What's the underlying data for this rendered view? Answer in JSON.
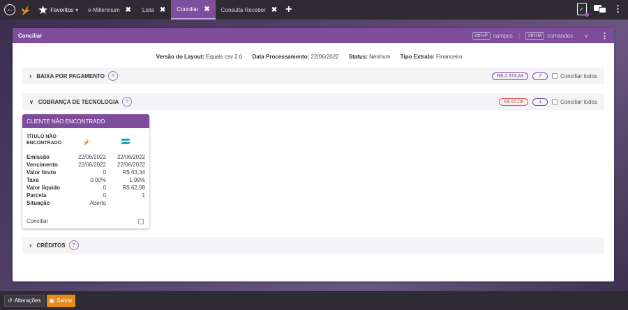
{
  "topbar": {
    "favorites_label": "Favoritos",
    "favorites_caret": "▾",
    "tabs": [
      {
        "label": "e-Millennium",
        "close": "✖"
      },
      {
        "label": "Lista",
        "close": "✖"
      },
      {
        "label": "Conciliar",
        "close": "✖"
      },
      {
        "label": "Consulta Receber",
        "close": "✖"
      }
    ],
    "add_tab": "+"
  },
  "panel": {
    "title": "Conciliar",
    "shortcut_fields_key": "ctrl+P",
    "shortcut_fields_label": "campos",
    "separator": "|",
    "shortcut_commands_key": "ctrl+M",
    "shortcut_commands_label": "comandos"
  },
  "info": {
    "layout_label": "Versão do Layout:",
    "layout_value": "Equals csv 2.0",
    "date_label": "Data Processamento:",
    "date_value": "22/06/2022",
    "status_label": "Status:",
    "status_value": "Nenhum",
    "type_label": "Tipo Extrato:",
    "type_value": "Financeiro"
  },
  "sections": {
    "baixa": {
      "title": "BAIXA POR PAGAMENTO",
      "help": "?",
      "amount": "R$ 2.373,43",
      "count": "7",
      "conciliate_all": "Conciliar todos"
    },
    "cobranca": {
      "title": "COBRANÇA DE TECNOLOGIA",
      "help": "?",
      "amount": "R$ 62,08",
      "count": "1",
      "conciliate_all": "Conciliar todos"
    },
    "creditos": {
      "title": "CRÉDITOS",
      "help": "?"
    }
  },
  "card": {
    "header": "CLIENTE NÃO ENCONTRADO",
    "subtitle_line1": "TÍTULO NÃO",
    "subtitle_line2": "ENCONTRADO",
    "rows": [
      {
        "label": "Emissão",
        "a": "22/06/2022",
        "b": "22/06/2022"
      },
      {
        "label": "Vencimento",
        "a": "22/06/2022",
        "b": "22/06/2022"
      },
      {
        "label": "Valor bruto",
        "a": "0",
        "b": "R$ 63,34"
      },
      {
        "label": "Taxa",
        "a": "0.00%",
        "b": "1.99%"
      },
      {
        "label": "Valor líquido",
        "a": "0",
        "b": "R$ 62,08"
      },
      {
        "label": "Parcela",
        "a": "0",
        "b": "1"
      },
      {
        "label": "Situação",
        "a": "Aberto",
        "b": ""
      }
    ],
    "footer_label": "Conciliar"
  },
  "bottombar": {
    "changes_label": "Alterações",
    "save_label": "Salvar"
  },
  "colors": {
    "accent": "#7d4c9b",
    "save": "#e68a1a",
    "alert": "#d9534f"
  }
}
